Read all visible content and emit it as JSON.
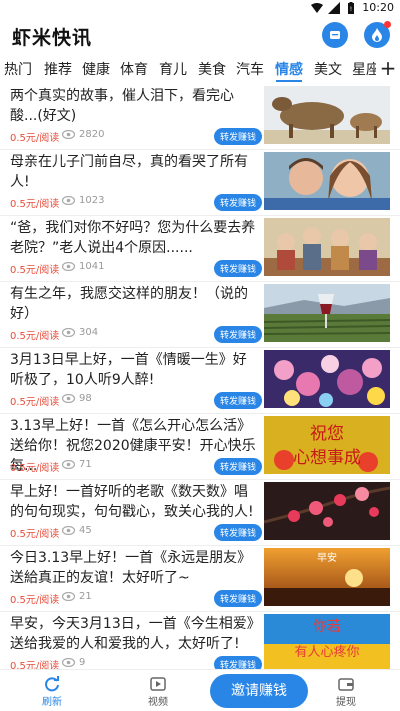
{
  "status": {
    "time": "10:20"
  },
  "header": {
    "title": "虾米快讯",
    "icons": [
      "wallet-icon",
      "flame-icon"
    ]
  },
  "tabs": [
    {
      "label": "热门"
    },
    {
      "label": "推荐"
    },
    {
      "label": "健康"
    },
    {
      "label": "体育"
    },
    {
      "label": "育儿"
    },
    {
      "label": "美食"
    },
    {
      "label": "汽车"
    },
    {
      "label": "情感",
      "active": true
    },
    {
      "label": "美文"
    },
    {
      "label": "星座"
    }
  ],
  "tab_more": "+",
  "articles": [
    {
      "title": "两个真实的故事，催人泪下，看完心酸...(好文)",
      "price": "0.5元/阅读",
      "views": "2820",
      "share": "转发赚钱"
    },
    {
      "title": "母亲在儿子门前自尽，真的看哭了所有人!",
      "price": "0.5元/阅读",
      "views": "1023",
      "share": "转发赚钱"
    },
    {
      "title": "“爸，我们对你不好吗？您为什么要去养老院？”老人说出4个原因......",
      "price": "0.5元/阅读",
      "views": "1041",
      "share": "转发赚钱"
    },
    {
      "title": "有生之年，我愿交这样的朋友！（说的好）",
      "price": "0.5元/阅读",
      "views": "304",
      "share": "转发赚钱"
    },
    {
      "title": "3月13日早上好，一首《情暖一生》好听极了，10人听9人醉!",
      "price": "0.5元/阅读",
      "views": "98",
      "share": "转发赚钱"
    },
    {
      "title": "3.13早上好！一首《怎么开心怎么活》送给你！祝您2020健康平安！开心快乐每...",
      "price": "0.5元/阅读",
      "views": "71",
      "share": "转发赚钱",
      "thumb_text": [
        "祝您",
        "心想事成"
      ]
    },
    {
      "title": "早上好！一首好听的老歌《数天数》唱的句句现实，句句戳心，致关心我的人!",
      "price": "0.5元/阅读",
      "views": "45",
      "share": "转发赚钱"
    },
    {
      "title": "今日3.13早上好！一首《永远是朋友》送給真正的友谊！太好听了~",
      "price": "0.5元/阅读",
      "views": "21",
      "share": "转发赚钱",
      "thumb_text": [
        "早安"
      ]
    },
    {
      "title": "早安，今天3月13日，一首《今生相爱》送给我爱的人和爱我的人，太好听了!",
      "price": "0.5元/阅读",
      "views": "9",
      "share": "转发赚钱",
      "thumb_text": [
        "你若",
        "有人心疼你"
      ]
    }
  ],
  "bottom_nav": {
    "refresh": "刷新",
    "video": "视频",
    "invite": "邀请赚钱",
    "withdraw": "提现"
  },
  "colors": {
    "accent": "#2a86e6",
    "price": "#e84d3b"
  }
}
